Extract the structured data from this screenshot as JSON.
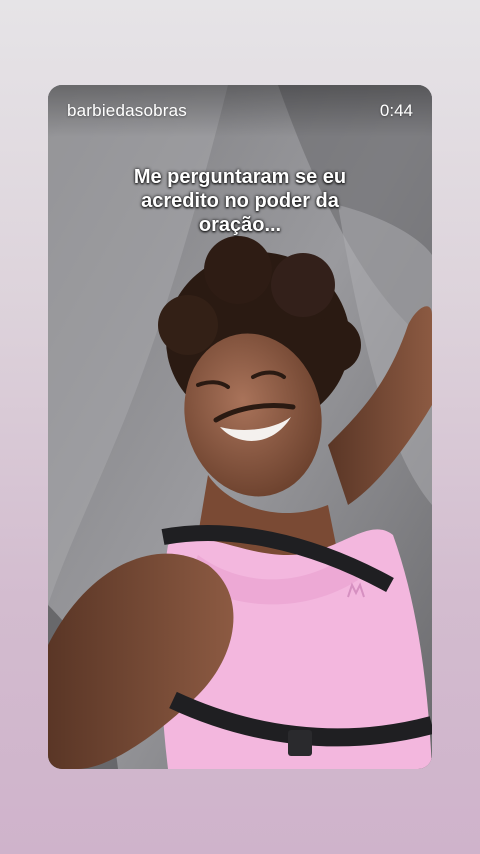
{
  "story": {
    "username": "barbiedasobras",
    "time": "0:44",
    "caption": "Me perguntaram se eu acredito no poder da oração..."
  },
  "colors": {
    "background_top": "#e6e4e7",
    "background_bottom": "#cfb3cb",
    "shirt": "#f3b7de",
    "couch": "#8a8a8e"
  }
}
